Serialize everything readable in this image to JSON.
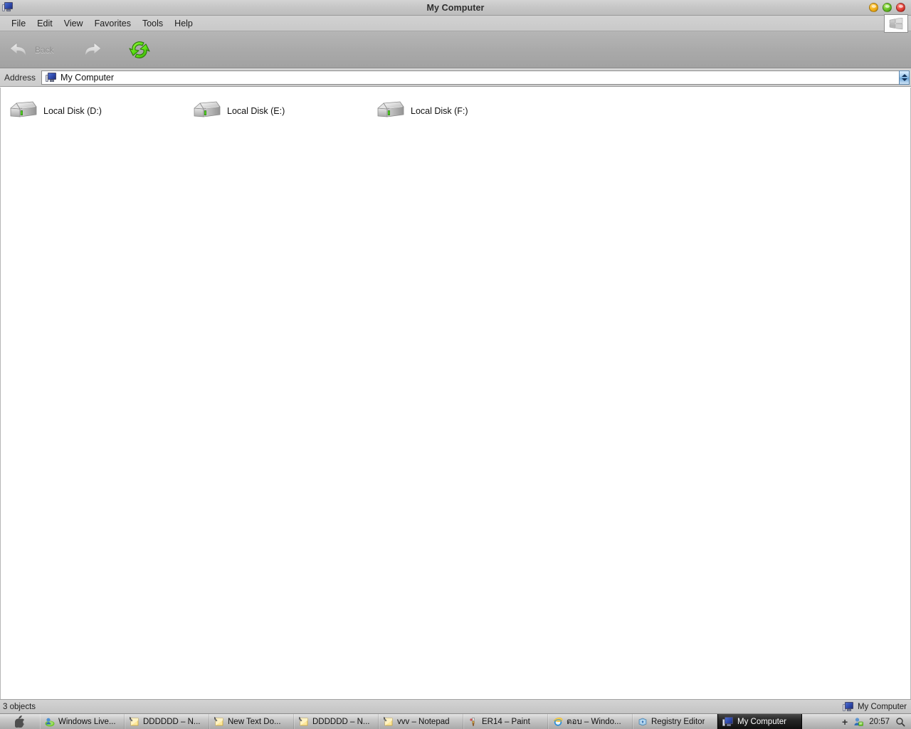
{
  "window": {
    "title": "My Computer",
    "icon": "my-computer-icon",
    "controls": [
      {
        "name": "minimize-button",
        "color": "#f6b41e"
      },
      {
        "name": "maximize-button",
        "color": "#6fc72c"
      },
      {
        "name": "close-button",
        "color": "#e8483f"
      }
    ]
  },
  "menubar": {
    "items": [
      "File",
      "Edit",
      "View",
      "Favorites",
      "Tools",
      "Help"
    ],
    "windows_logo_button": "windows-logo-button"
  },
  "toolbar": {
    "back_label": "Back",
    "back_icon": "back-arrow-icon",
    "forward_icon": "forward-arrow-icon",
    "refresh_icon": "refresh-sync-icon"
  },
  "address": {
    "label": "Address",
    "value": "My Computer",
    "icon": "my-computer-icon",
    "stepper": "address-stepper"
  },
  "content": {
    "drives": [
      {
        "label": "Local Disk (D:)",
        "icon": "hard-disk-icon"
      },
      {
        "label": "Local Disk (E:)",
        "icon": "hard-disk-icon"
      },
      {
        "label": "Local Disk (F:)",
        "icon": "hard-disk-icon"
      }
    ]
  },
  "statusbar": {
    "object_count": "3 objects",
    "location": "My Computer",
    "location_icon": "my-computer-icon"
  },
  "taskbar": {
    "start_button": "apple-logo-start-button",
    "start_glyph": "",
    "items": [
      {
        "label": "Windows Live...",
        "icon": "windows-live-messenger-icon",
        "active": false
      },
      {
        "label": "DDDDDD – N...",
        "icon": "notepad-icon",
        "active": false
      },
      {
        "label": "New Text Do...",
        "icon": "notepad-icon",
        "active": false
      },
      {
        "label": "DDDDDD – N...",
        "icon": "notepad-icon",
        "active": false
      },
      {
        "label": "vvv – Notepad",
        "icon": "notepad-icon",
        "active": false
      },
      {
        "label": "ER14 – Paint",
        "icon": "paint-icon",
        "active": false
      },
      {
        "label": "ตอบ – Windo...",
        "icon": "internet-explorer-icon",
        "active": false
      },
      {
        "label": "Registry Editor",
        "icon": "registry-editor-icon",
        "active": false
      },
      {
        "label": "My Computer",
        "icon": "my-computer-icon",
        "active": true
      }
    ],
    "tray": {
      "plus_icon": "plus-icon",
      "messenger_icon": "messenger-contact-icon",
      "time": "20:57",
      "search_icon": "search-magnifier-icon"
    }
  },
  "colors": {
    "titlebar": "#c8c8c8",
    "toolbar": "#aaaaaa",
    "content_bg": "#ffffff",
    "accent_green": "#6fc72c",
    "accent_red": "#e8483f",
    "accent_yellow": "#f6b41e"
  }
}
